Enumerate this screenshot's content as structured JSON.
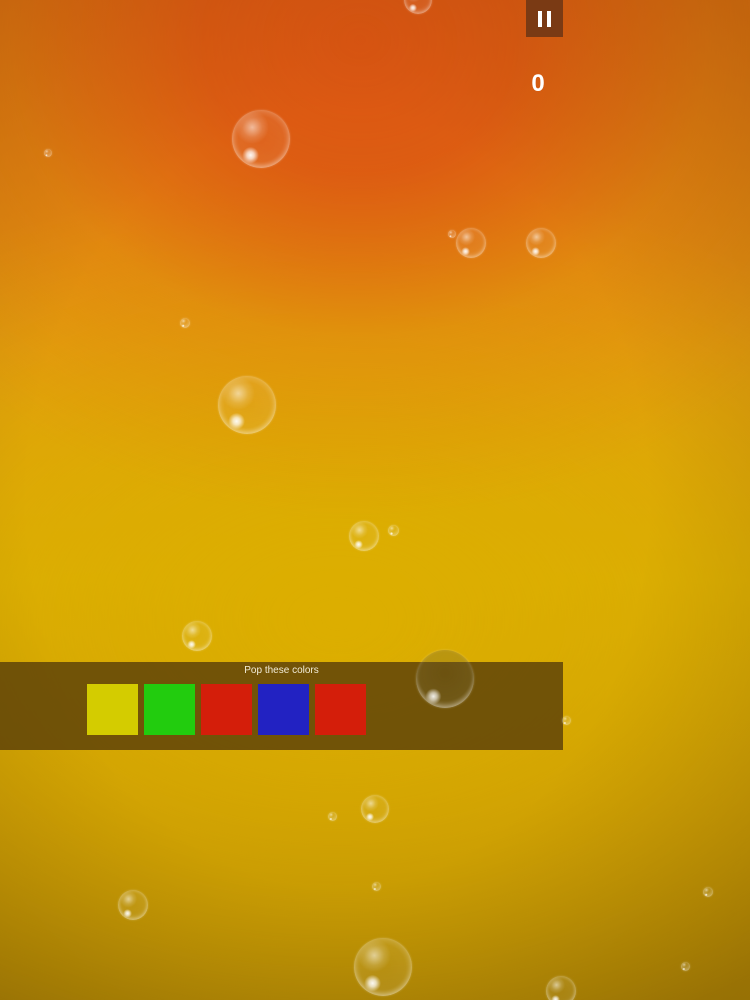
{
  "game": {
    "score": "0",
    "pause_icon": "pause-icon"
  },
  "target_panel": {
    "title": "Pop these colors",
    "colors": [
      {
        "name": "yellow",
        "hex": "#d4cc00"
      },
      {
        "name": "green",
        "hex": "#22cc0e"
      },
      {
        "name": "red",
        "hex": "#d41e0a"
      },
      {
        "name": "blue",
        "hex": "#2222c2"
      },
      {
        "name": "red",
        "hex": "#d41e0a"
      }
    ]
  },
  "colors": {
    "pause_button_bg": "#7a3a14",
    "panel_bg": "#5a4008",
    "background_top": "#dc5612",
    "background_bottom": "#ab8306"
  }
}
